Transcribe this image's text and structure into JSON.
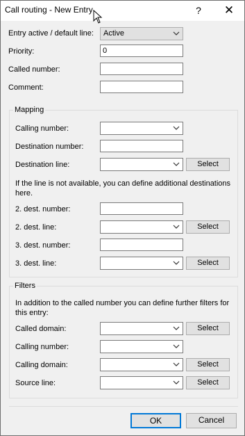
{
  "window": {
    "title": "Call routing - New Entry",
    "help_glyph": "?",
    "close_glyph": "✕"
  },
  "main": {
    "entry_active_label": "Entry active / default line:",
    "entry_active_value": "Active",
    "priority_label": "Priority:",
    "priority_value": "0",
    "called_number_label": "Called number:",
    "called_number_value": "",
    "comment_label": "Comment:",
    "comment_value": ""
  },
  "mapping": {
    "group_label": "Mapping",
    "calling_number_label": "Calling number:",
    "calling_number_value": "",
    "destination_number_label": "Destination number:",
    "destination_number_value": "",
    "destination_line_label": "Destination line:",
    "destination_line_value": "",
    "info_text": "If the line is not available, you can define additional destinations here.",
    "dest2_number_label": "2. dest. number:",
    "dest2_number_value": "",
    "dest2_line_label": "2. dest. line:",
    "dest2_line_value": "",
    "dest3_number_label": "3. dest. number:",
    "dest3_number_value": "",
    "dest3_line_label": "3. dest. line:",
    "dest3_line_value": "",
    "select_label": "Select"
  },
  "filters": {
    "group_label": "Filters",
    "info_text": "In addition to the called number you can define further filters for this entry:",
    "called_domain_label": "Called domain:",
    "called_domain_value": "",
    "calling_number_label": "Calling number:",
    "calling_number_value": "",
    "calling_domain_label": "Calling domain:",
    "calling_domain_value": "",
    "source_line_label": "Source line:",
    "source_line_value": "",
    "select_label": "Select"
  },
  "footer": {
    "ok_label": "OK",
    "cancel_label": "Cancel"
  },
  "colors": {
    "dialog_bg": "#f0f0f0",
    "default_button_border": "#0078d7"
  }
}
